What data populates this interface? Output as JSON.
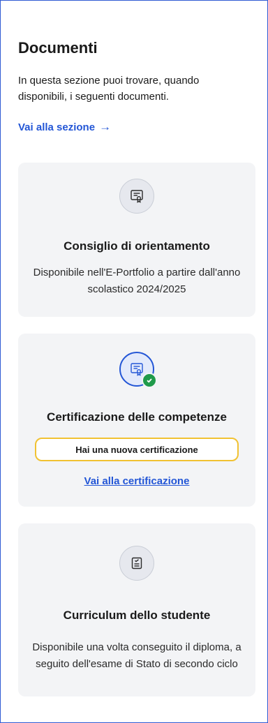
{
  "section": {
    "title": "Documenti",
    "intro": "In questa sezione puoi trovare, quando disponibili, i seguenti documenti.",
    "link_label": "Vai alla sezione",
    "link_arrow": "→"
  },
  "cards": [
    {
      "icon": "certificate-icon",
      "title": "Consiglio di orientamento",
      "description": "Disponibile nell'E-Portfolio a partire dall'anno scolastico 2024/2025"
    },
    {
      "icon": "certificate-icon",
      "status_icon": "check-badge-icon",
      "title": "Certificazione delle competenze",
      "notice": "Hai una nuova certificazione",
      "link_label": "Vai alla certificazione"
    },
    {
      "icon": "checklist-document-icon",
      "title": "Curriculum dello studente",
      "description": "Disponibile una volta conseguito il diploma, a seguito dell'esame di Stato di secondo ciclo"
    }
  ],
  "colors": {
    "accent": "#2356d6",
    "card_background": "#f3f4f6",
    "notice_border": "#f1c232",
    "success": "#1f9a4a",
    "frame_border": "#2f5bd3"
  }
}
